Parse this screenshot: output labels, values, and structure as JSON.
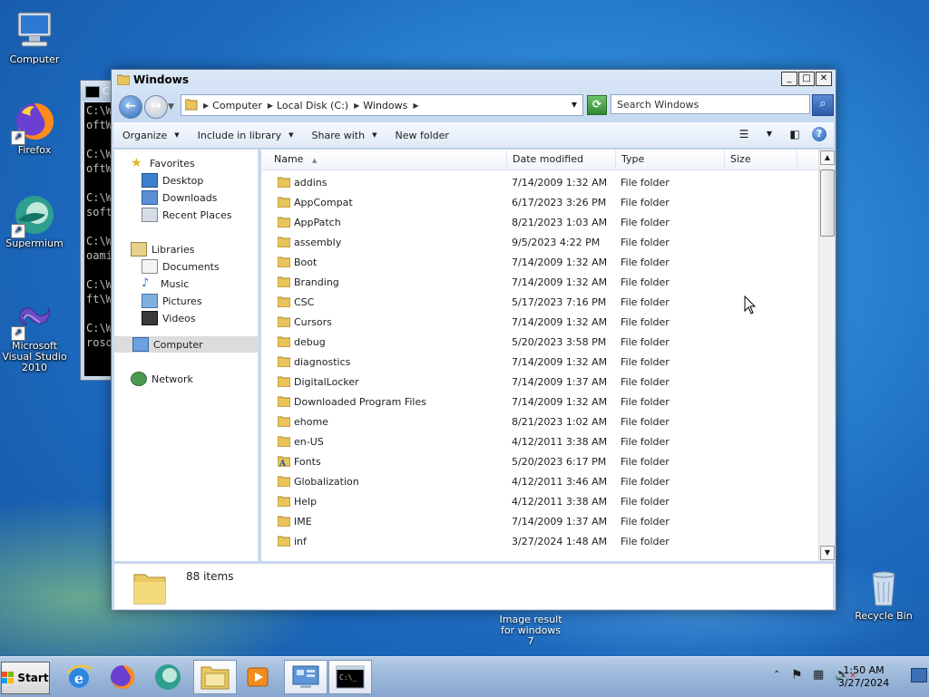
{
  "desktop": {
    "icons": [
      {
        "label": "Computer"
      },
      {
        "label": "Firefox"
      },
      {
        "label": "Supermium"
      },
      {
        "label": "Microsoft Visual Studio 2010"
      },
      {
        "label": "Recycle Bin"
      }
    ],
    "caption": "Image result for windows 7"
  },
  "cmd": {
    "title": "C:\\",
    "lines": [
      "C:\\W",
      "oftW",
      "",
      "C:\\W",
      "oftW",
      "",
      "C:\\W",
      "soft",
      "",
      "C:\\W",
      "oami",
      "",
      "C:\\W",
      "ft\\W",
      "",
      "C:\\W",
      "roso"
    ]
  },
  "explorer": {
    "title": "Windows",
    "address": {
      "crumbs": [
        "Computer",
        "Local Disk (C:)",
        "Windows"
      ]
    },
    "search_placeholder": "Search Windows",
    "toolbar": {
      "organize": "Organize",
      "include": "Include in library",
      "share": "Share with",
      "new_folder": "New folder"
    },
    "nav": {
      "favorites": "Favorites",
      "desktop": "Desktop",
      "downloads": "Downloads",
      "recent": "Recent Places",
      "libraries": "Libraries",
      "documents": "Documents",
      "music": "Music",
      "pictures": "Pictures",
      "videos": "Videos",
      "computer": "Computer",
      "network": "Network"
    },
    "columns": {
      "name": "Name",
      "date": "Date modified",
      "type": "Type",
      "size": "Size"
    },
    "rows": [
      {
        "name": "addins",
        "date": "7/14/2009 1:32 AM",
        "type": "File folder"
      },
      {
        "name": "AppCompat",
        "date": "6/17/2023 3:26 PM",
        "type": "File folder"
      },
      {
        "name": "AppPatch",
        "date": "8/21/2023 1:03 AM",
        "type": "File folder"
      },
      {
        "name": "assembly",
        "date": "9/5/2023 4:22 PM",
        "type": "File folder"
      },
      {
        "name": "Boot",
        "date": "7/14/2009 1:32 AM",
        "type": "File folder"
      },
      {
        "name": "Branding",
        "date": "7/14/2009 1:32 AM",
        "type": "File folder"
      },
      {
        "name": "CSC",
        "date": "5/17/2023 7:16 PM",
        "type": "File folder"
      },
      {
        "name": "Cursors",
        "date": "7/14/2009 1:32 AM",
        "type": "File folder"
      },
      {
        "name": "debug",
        "date": "5/20/2023 3:58 PM",
        "type": "File folder"
      },
      {
        "name": "diagnostics",
        "date": "7/14/2009 1:32 AM",
        "type": "File folder"
      },
      {
        "name": "DigitalLocker",
        "date": "7/14/2009 1:37 AM",
        "type": "File folder"
      },
      {
        "name": "Downloaded Program Files",
        "date": "7/14/2009 1:32 AM",
        "type": "File folder"
      },
      {
        "name": "ehome",
        "date": "8/21/2023 1:02 AM",
        "type": "File folder"
      },
      {
        "name": "en-US",
        "date": "4/12/2011 3:38 AM",
        "type": "File folder"
      },
      {
        "name": "Fonts",
        "date": "5/20/2023 6:17 PM",
        "type": "File folder"
      },
      {
        "name": "Globalization",
        "date": "4/12/2011 3:46 AM",
        "type": "File folder"
      },
      {
        "name": "Help",
        "date": "4/12/2011 3:38 AM",
        "type": "File folder"
      },
      {
        "name": "IME",
        "date": "7/14/2009 1:37 AM",
        "type": "File folder"
      },
      {
        "name": "inf",
        "date": "3/27/2024 1:48 AM",
        "type": "File folder"
      }
    ],
    "item_count": "88 items"
  },
  "taskbar": {
    "start_label": "Start",
    "time": "1:50 AM",
    "date": "3/27/2024"
  }
}
